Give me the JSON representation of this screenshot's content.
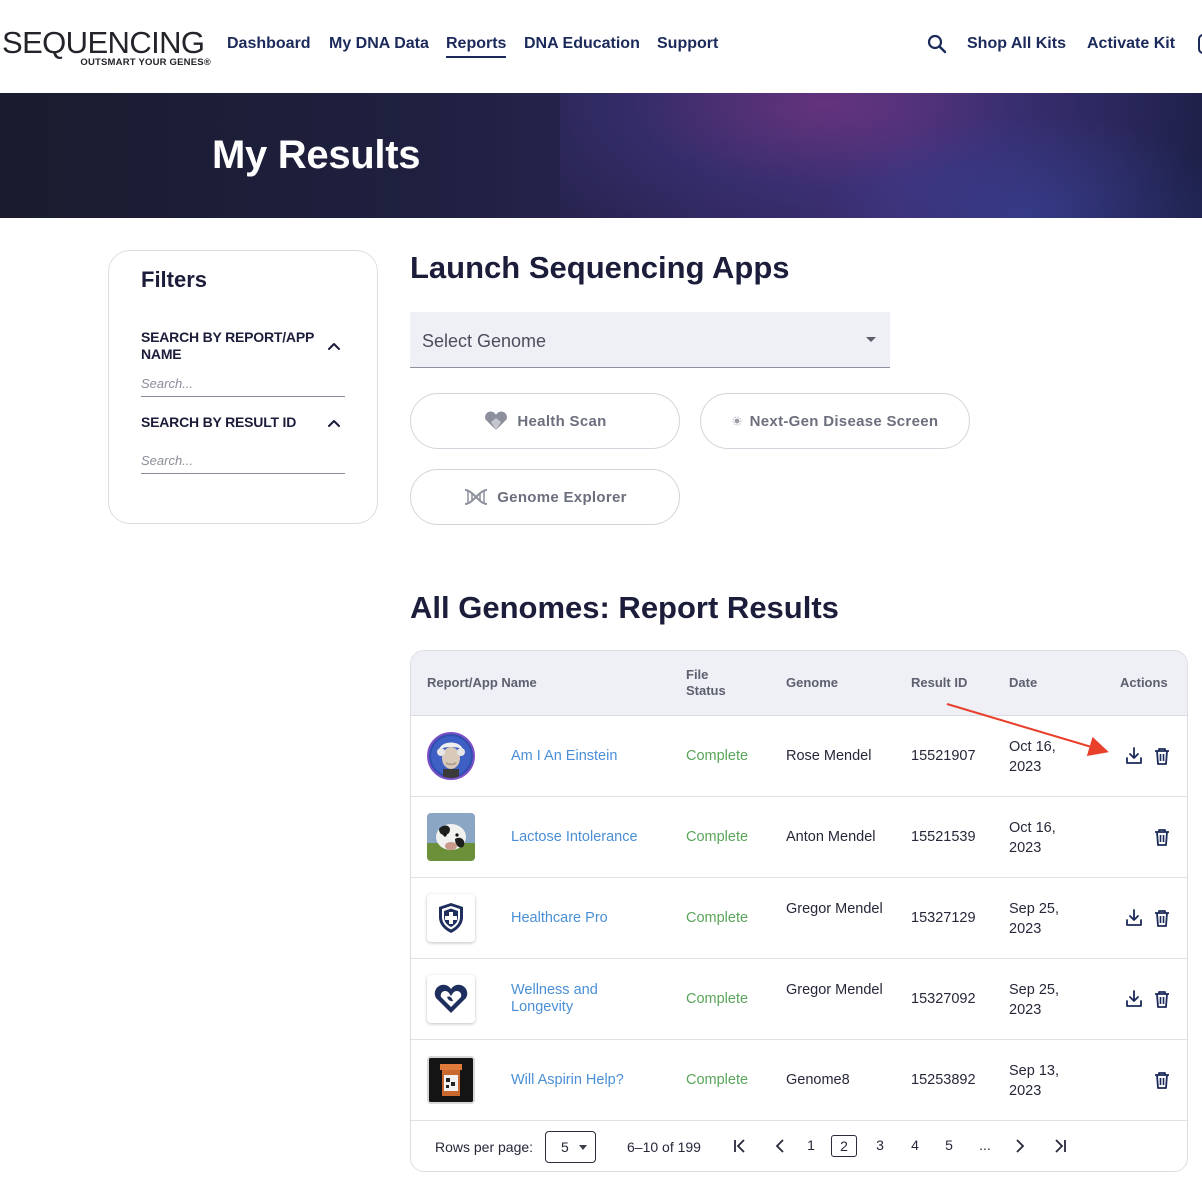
{
  "brand": {
    "name": "SEQUENCING",
    "tagline": "OUTSMART YOUR GENES®"
  },
  "nav": {
    "items": [
      {
        "label": "Dashboard"
      },
      {
        "label": "My DNA Data"
      },
      {
        "label": "Reports"
      },
      {
        "label": "DNA Education"
      },
      {
        "label": "Support"
      }
    ],
    "active": "Reports",
    "shop_label": "Shop All Kits",
    "activate_label": "Activate Kit"
  },
  "hero": {
    "title": "My Results"
  },
  "filters": {
    "title": "Filters",
    "report_label": "SEARCH BY REPORT/APP NAME",
    "report_placeholder": "Search...",
    "result_label": "SEARCH BY RESULT ID",
    "result_placeholder": "Search..."
  },
  "launch": {
    "title": "Launch Sequencing Apps",
    "select_placeholder": "Select Genome",
    "apps": [
      {
        "label": "Health Scan",
        "icon": "heart-icon"
      },
      {
        "label": "Next-Gen Disease Screen",
        "icon": "gear-dot-icon"
      },
      {
        "label": "Genome Explorer",
        "icon": "dna-helix-icon"
      }
    ]
  },
  "results": {
    "title": "All Genomes: Report Results",
    "columns": [
      "Report/App Name",
      "File Status",
      "Genome",
      "Result ID",
      "Date",
      "Actions"
    ],
    "rows": [
      {
        "name": "Am I An Einstein",
        "status": "Complete",
        "genome": "Rose Mendel",
        "result_id": "15521907",
        "date": "Oct 16, 2023",
        "download": true,
        "thumb": "einstein-portrait"
      },
      {
        "name": "Lactose Intolerance",
        "status": "Complete",
        "genome": "Anton Mendel",
        "result_id": "15521539",
        "date": "Oct 16, 2023",
        "download": false,
        "thumb": "cow-photo"
      },
      {
        "name": "Healthcare Pro",
        "status": "Complete",
        "genome": "Gregor Mendel",
        "result_id": "15327129",
        "date": "Sep 25, 2023",
        "download": true,
        "thumb": "shield-cross-icon"
      },
      {
        "name": "Wellness and Longevity",
        "status": "Complete",
        "genome": "Gregor Mendel",
        "result_id": "15327092",
        "date": "Sep 25, 2023",
        "download": true,
        "thumb": "heart-leaf-icon"
      },
      {
        "name": "Will Aspirin Help?",
        "status": "Complete",
        "genome": "Genome8",
        "result_id": "15253892",
        "date": "Sep 13, 2023",
        "download": false,
        "thumb": "pill-bottle-icon"
      }
    ],
    "pagination": {
      "rows_label": "Rows per page:",
      "rows_value": "5",
      "range": "6–10 of 199",
      "pages": [
        "1",
        "2",
        "3",
        "4",
        "5",
        "..."
      ],
      "current": "2"
    }
  },
  "colors": {
    "nav_text": "#1b2a5a",
    "link": "#4a8fd6",
    "status_complete": "#5aa55a",
    "annotation_arrow": "#e8402a"
  }
}
